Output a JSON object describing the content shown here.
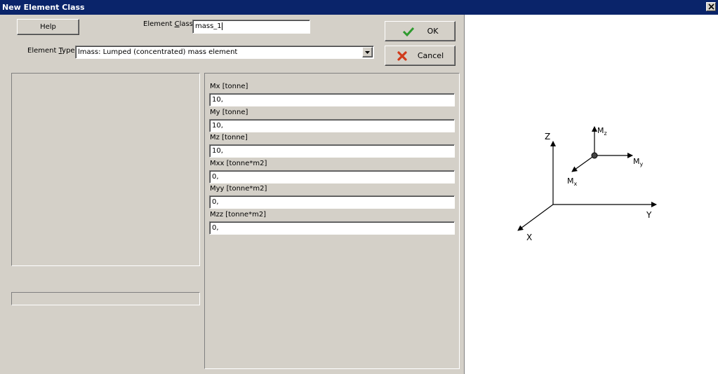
{
  "window": {
    "title": "New Element Class"
  },
  "toolbar": {
    "help_label": "Help",
    "ok_label": "OK",
    "cancel_label": "Cancel"
  },
  "form": {
    "element_class_label_pre": "Element ",
    "element_class_label_u": "C",
    "element_class_label_post": "lass:",
    "element_class_value": "mass_1",
    "element_type_label_pre": "Element ",
    "element_type_label_u": "T",
    "element_type_label_post": "ype:",
    "element_type_value": "lmass: Lumped (concentrated) mass element"
  },
  "params": [
    {
      "label": "Mx [tonne]",
      "value": "10,"
    },
    {
      "label": "My [tonne]",
      "value": "10,"
    },
    {
      "label": "Mz [tonne]",
      "value": "10,"
    },
    {
      "label": "Mxx [tonne*m2]",
      "value": "0,"
    },
    {
      "label": "Myy [tonne*m2]",
      "value": "0,"
    },
    {
      "label": "Mzz [tonne*m2]",
      "value": "0,"
    }
  ],
  "diagram": {
    "axis_z": "Z",
    "axis_y": "Y",
    "axis_x": "X",
    "mz": "M",
    "mz_sub": "z",
    "my": "M",
    "my_sub": "y",
    "mx": "M",
    "mx_sub": "x"
  }
}
